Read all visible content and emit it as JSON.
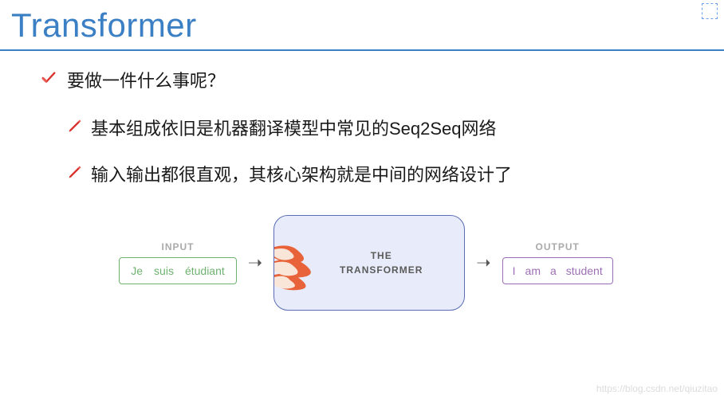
{
  "title": "Transformer",
  "question": "要做一件什么事呢？",
  "points": [
    "基本组成依旧是机器翻译模型中常见的Seq2Seq网络",
    "输入输出都很直观，其核心架构就是中间的网络设计了"
  ],
  "diagram": {
    "input_label": "INPUT",
    "input_tokens": [
      "Je",
      "suis",
      "étudiant"
    ],
    "center_label_line1": "THE",
    "center_label_line2": "TRANSFORMER",
    "output_label": "OUTPUT",
    "output_tokens": [
      "I",
      "am",
      "a",
      "student"
    ]
  },
  "watermark": "https://blog.csdn.net/qiuzitao"
}
